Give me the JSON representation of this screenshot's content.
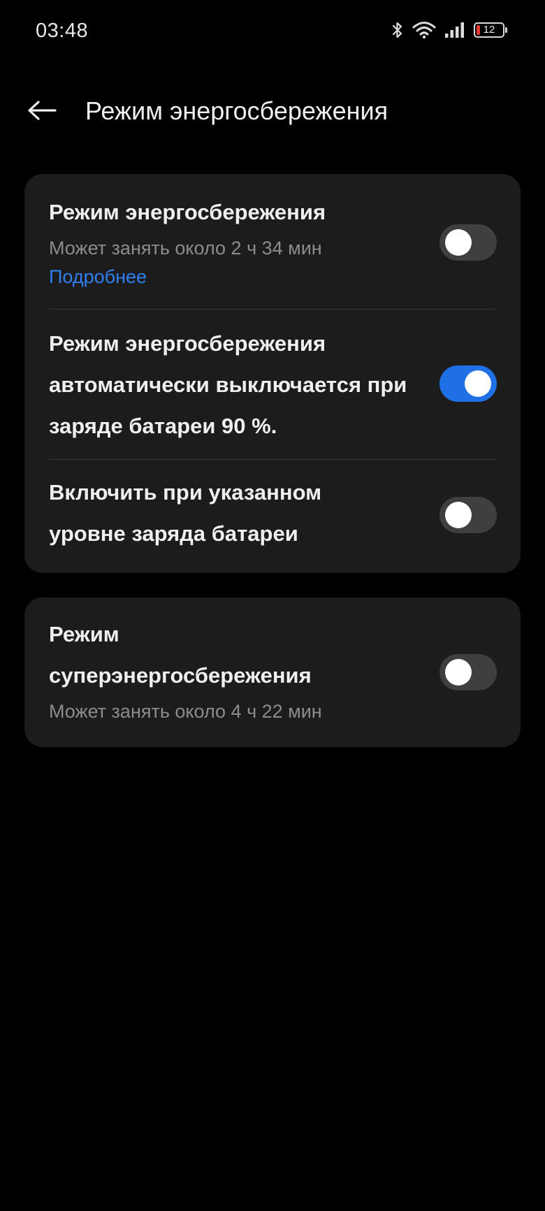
{
  "status_bar": {
    "time": "03:48",
    "battery_level": "12",
    "icons": [
      "bluetooth-icon",
      "wifi-icon",
      "signal-icon",
      "battery-icon"
    ]
  },
  "header": {
    "back_icon": "arrow-left-icon",
    "title": "Режим энергосбережения"
  },
  "card_main": {
    "power_saving": {
      "title": "Режим энергосбережения",
      "subtitle": "Может занять около 2 ч 34 мин",
      "link": "Подробнее",
      "enabled": false
    },
    "auto_off": {
      "title": "Режим энергосбережения автоматически выключается при заряде батареи 90 %.",
      "enabled": true
    },
    "turn_on_at_level": {
      "title": "Включить при указанном уровне заряда батареи",
      "enabled": false
    }
  },
  "card_super": {
    "super_power_saving": {
      "title": "Режим суперэнергосбережения",
      "subtitle": "Может занять около 4 ч 22 мин",
      "enabled": false
    }
  },
  "colors": {
    "background": "#000000",
    "card": "#1c1c1c",
    "accent": "#1f6fe5",
    "link": "#2f7ff0",
    "toggle_off": "#3f3f3f",
    "battery_low": "#e53935"
  }
}
